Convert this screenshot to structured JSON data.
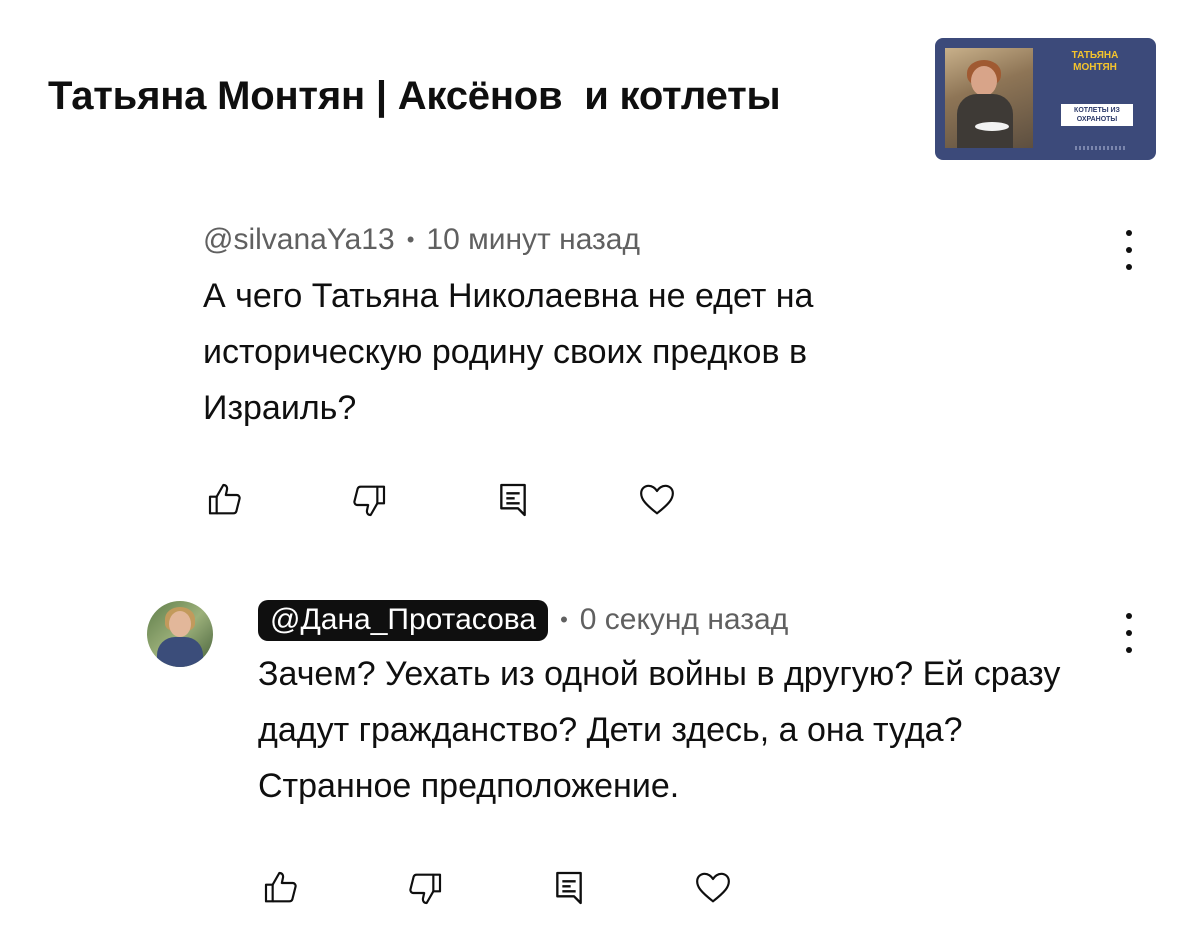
{
  "video": {
    "title": "Татьяна Монтян | Аксёнов  и котлеты",
    "thumbnail": {
      "name_line1": "ТАТЬЯНА",
      "name_line2": "МОНТЯН",
      "box_line1": "КОТЛЕТЫ ИЗ",
      "box_line2": "ОХРАНОТЫ"
    }
  },
  "comments": [
    {
      "author": "@silvanaYa13",
      "time": "10 минут назад",
      "text": "А чего Татьяна Николаевна не едет на историческую родину своих предков в Израиль?"
    },
    {
      "author": "@Дана_Протасова",
      "time": "0 секунд назад",
      "text": "Зачем? Уехать из одной войны в другую? Ей сразу дадут гражданство? Дети здесь, а она туда? Странное предположение."
    }
  ],
  "icons": [
    "thumbs-up-icon",
    "thumbs-down-icon",
    "reply-icon",
    "heart-icon",
    "more-vert-icon"
  ],
  "colors": {
    "text": "#0f0f0f",
    "secondary": "#606060",
    "pill": "#0f0f0f",
    "thumb_bg": "#3c4a7a",
    "thumb_accent": "#f5c42c"
  }
}
